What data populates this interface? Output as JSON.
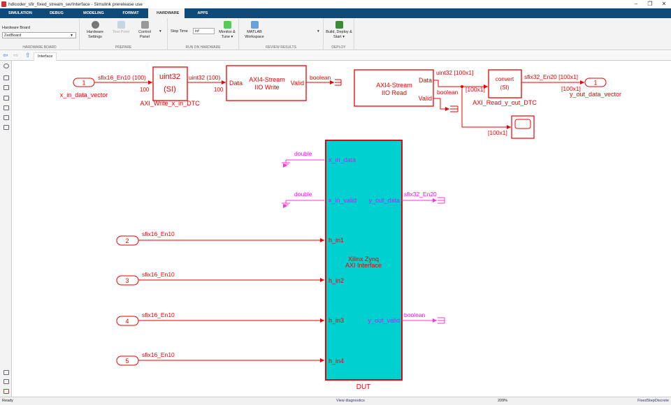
{
  "window": {
    "title": "hdlcoder_sfir_fixed_stream_sw/Interface - Simulink prerelease use",
    "minimize": "–",
    "maximize": "❐",
    "close": "✕"
  },
  "tabs": [
    {
      "label": "SIMULATION"
    },
    {
      "label": "DEBUG"
    },
    {
      "label": "MODELING"
    },
    {
      "label": "FORMAT"
    },
    {
      "label": "HARDWARE",
      "active": true
    },
    {
      "label": "APPS"
    }
  ],
  "ribbon": {
    "hardware_board": {
      "label": "Hardware Board",
      "value": "ZedBoard",
      "section": "HARDWARE BOARD"
    },
    "prepare": {
      "hardware_settings": "Hardware Settings",
      "test_point": "Test Point",
      "control_panel": "Control Panel",
      "section": "PREPARE"
    },
    "run": {
      "stop_time_label": "Stop Time",
      "stop_time_value": "inf",
      "monitor_tune": "Monitor & Tune ▾",
      "section": "RUN ON HARDWARE"
    },
    "review": {
      "matlab_workspace": "MATLAB Workspace",
      "section": "REVIEW RESULTS"
    },
    "deploy": {
      "build": "Build, Deploy & Start ▾",
      "section": "DEPLOY"
    }
  },
  "breadcrumb": {
    "tab": "Interface"
  },
  "diagram": {
    "in1": {
      "num": "1",
      "name": "x_in_data_vector",
      "sig": "sfix16_En10 (100)",
      "dim": "100"
    },
    "dtc_write": {
      "line1": "uint32",
      "line2": "(SI)",
      "name": "AXI_Write_x_in_DTC",
      "sig": "uint32 (100)",
      "dim": "100"
    },
    "iio_write": {
      "line1": "AXI4-Stream",
      "line2": "IIO Write",
      "port_in": "Data",
      "port_out": "Valid",
      "sig": "boolean"
    },
    "iio_read": {
      "line1": "AXI4-Stream",
      "line2": "IIO Read",
      "port_data": "Data",
      "port_valid": "Valid",
      "sig_data": "uint32 [100x1]",
      "sig_valid": "boolean",
      "dim_a": "[100x1]",
      "dim_b": "[100x1]"
    },
    "dtc_read": {
      "line1": "convert",
      "line2": "(SI)",
      "name": "AXI_Read_y_out_DTC",
      "sig": "sfix32_En20 [100x1]",
      "dim": "[100x1]"
    },
    "out1": {
      "num": "1",
      "name": "y_out_data_vector"
    },
    "dut": {
      "name": "DUT",
      "line1": "Xilinx Zynq",
      "line2": "AXI Interface",
      "ports_in": [
        "x_in_data",
        "x_in_valid",
        "h_in1",
        "h_in2",
        "h_in3",
        "h_in4"
      ],
      "ports_out": [
        "y_out_data",
        "y_out_valid"
      ],
      "sig_in_ground": "double",
      "sig_out_data": "sfix32_En20",
      "sig_out_valid": "boolean"
    },
    "inports": [
      {
        "num": "2",
        "sig": "sfix16_En10"
      },
      {
        "num": "3",
        "sig": "sfix16_En10"
      },
      {
        "num": "4",
        "sig": "sfix16_En10"
      },
      {
        "num": "5",
        "sig": "sfix16_En10"
      }
    ]
  },
  "status": {
    "left": "Ready",
    "center": "View diagnostics",
    "zoom": "209%",
    "solver": "FixedStepDiscrete"
  },
  "colors": {
    "tabbar": "#0e4a7a",
    "block": "#e00000",
    "dut_fill": "#00d0d0",
    "magenta": "#ff33dd"
  }
}
